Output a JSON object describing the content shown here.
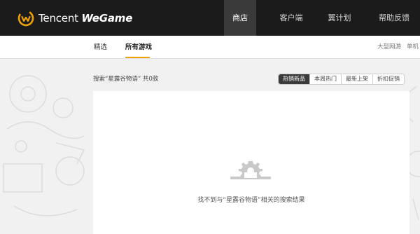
{
  "brand": {
    "logo_text_prefix": "Tencent ",
    "logo_text_emph": "WeGame"
  },
  "top_nav": {
    "items": [
      {
        "label": "商店",
        "active": true
      },
      {
        "label": "客户端",
        "active": false
      },
      {
        "label": "翼计划",
        "active": false
      },
      {
        "label": "帮助反馈",
        "active": false
      }
    ]
  },
  "sub_nav": {
    "tabs": [
      {
        "label": "精选",
        "active": false
      },
      {
        "label": "所有游戏",
        "active": true
      }
    ],
    "right_links": [
      "大型网游",
      "单机"
    ]
  },
  "search": {
    "summary": "搜索“星露谷物语” 共0款"
  },
  "sort": {
    "options": [
      {
        "label": "热销新品",
        "active": true
      },
      {
        "label": "本周热门",
        "active": false
      },
      {
        "label": "最新上架",
        "active": false
      },
      {
        "label": "折扣促销",
        "active": false
      }
    ]
  },
  "results": {
    "empty_message": "找不到与“星露谷物语”相关的搜索结果"
  },
  "colors": {
    "topbar_bg": "#1b1b1b",
    "active_nav_bg": "#3a3a3a",
    "accent": "#f0a400",
    "page_bg": "#f1f1f1"
  }
}
